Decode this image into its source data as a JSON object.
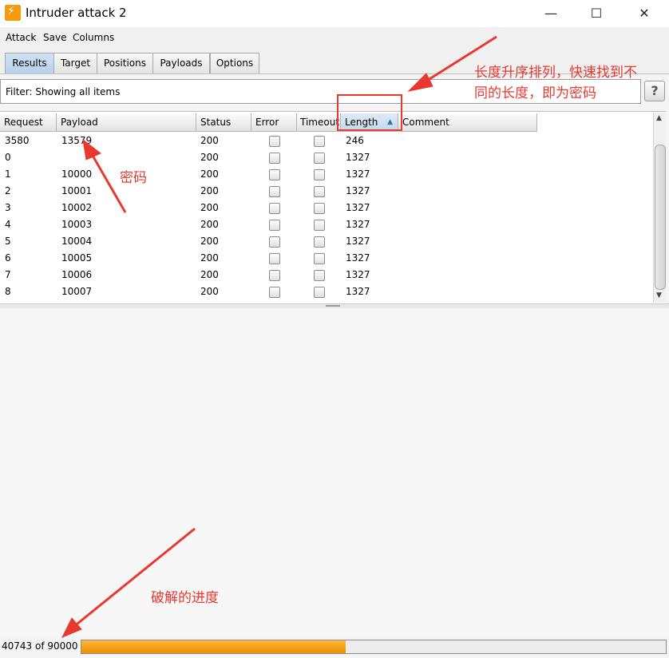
{
  "window": {
    "title": "Intruder attack 2",
    "controls": [
      "—",
      "☐",
      "✕"
    ]
  },
  "menu": [
    "Attack",
    "Save",
    "Columns"
  ],
  "tabs": [
    {
      "label": "Results",
      "active": true
    },
    {
      "label": "Target"
    },
    {
      "label": "Positions"
    },
    {
      "label": "Payloads"
    },
    {
      "label": "Options"
    }
  ],
  "filter": {
    "text": "Filter: Showing all items",
    "help": "?"
  },
  "table": {
    "columns": [
      "Request",
      "Payload",
      "Status",
      "Error",
      "Timeout",
      "Length",
      "Comment"
    ],
    "sorted_column": "Length",
    "sort_indicator": "▲",
    "rows": [
      {
        "request": "3580",
        "payload": "13579",
        "status": "200",
        "length": "246"
      },
      {
        "request": "0",
        "payload": "",
        "status": "200",
        "length": "1327"
      },
      {
        "request": "1",
        "payload": "10000",
        "status": "200",
        "length": "1327"
      },
      {
        "request": "2",
        "payload": "10001",
        "status": "200",
        "length": "1327"
      },
      {
        "request": "3",
        "payload": "10002",
        "status": "200",
        "length": "1327"
      },
      {
        "request": "4",
        "payload": "10003",
        "status": "200",
        "length": "1327"
      },
      {
        "request": "5",
        "payload": "10004",
        "status": "200",
        "length": "1327"
      },
      {
        "request": "6",
        "payload": "10005",
        "status": "200",
        "length": "1327"
      },
      {
        "request": "7",
        "payload": "10006",
        "status": "200",
        "length": "1327"
      },
      {
        "request": "8",
        "payload": "10007",
        "status": "200",
        "length": "1327"
      }
    ]
  },
  "progress": {
    "text": "40743 of 90000",
    "done": 40743,
    "total": 90000
  },
  "annotations": {
    "sort_note_line1": "长度升序排列，快速找到不",
    "sort_note_line2": "同的长度，即为密码",
    "password_note": "密码",
    "progress_note": "破解的进度",
    "color": "#e8382f"
  },
  "colors": {
    "accent": "#ef8f00",
    "active_tab": "#b7d1ec"
  }
}
